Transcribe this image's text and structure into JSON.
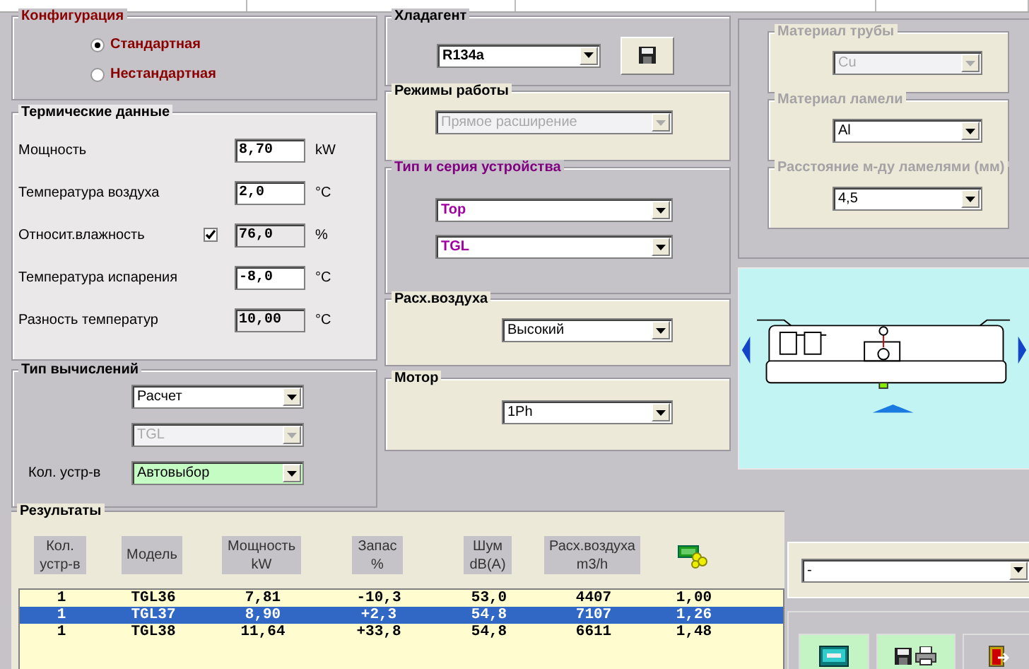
{
  "configuration": {
    "title": "Конфигурация",
    "options": [
      {
        "label": "Стандартная",
        "selected": true
      },
      {
        "label": "Нестандартная",
        "selected": false
      }
    ]
  },
  "thermal": {
    "title": "Термические данные",
    "rows": [
      {
        "label": "Мощность",
        "value": "8,70",
        "unit": "kW",
        "editable": true
      },
      {
        "label": "Температура воздуха",
        "value": "2,0",
        "unit": "°C",
        "editable": true
      },
      {
        "label": "Относит.влажность",
        "value": "76,0",
        "unit": "%",
        "editable": false,
        "checkbox": {
          "checked": true
        }
      },
      {
        "label": "Температура испарения",
        "value": "-8,0",
        "unit": "°C",
        "editable": true
      },
      {
        "label": "Разность температур",
        "value": "10,00",
        "unit": "°C",
        "editable": false
      }
    ]
  },
  "calculation": {
    "title": "Тип вычислений",
    "selects": [
      {
        "value": "Расчет",
        "disabled": false,
        "highlighted": false
      },
      {
        "value": "TGL",
        "disabled": true,
        "highlighted": false
      },
      {
        "label": "Кол. устр-в",
        "value": "Автовыбор",
        "disabled": false,
        "highlighted": true
      }
    ]
  },
  "refrigerant": {
    "title": "Хладагент",
    "value": "R134a"
  },
  "mode": {
    "title": "Режимы работы",
    "value": "Прямое расширение",
    "disabled": true
  },
  "device": {
    "title": "Тип и серия устройства",
    "selects": [
      {
        "value": "Top"
      },
      {
        "value": "TGL"
      }
    ]
  },
  "airflow": {
    "title": "Расх.воздуха",
    "value": "Высокий"
  },
  "motor": {
    "title": "Мотор",
    "value": "1Ph"
  },
  "materials": [
    {
      "title": "Материал трубы",
      "value": "Cu",
      "disabled": true
    },
    {
      "title": "Материал ламели",
      "value": "Al",
      "disabled": false
    },
    {
      "title": "Расстояние м-ду ламелями (мм)",
      "value": "4,5",
      "disabled": false
    }
  ],
  "results": {
    "title": "Результаты",
    "columns": [
      {
        "lines": [
          "Кол.",
          "устр-в"
        ]
      },
      {
        "lines": [
          "Модель"
        ]
      },
      {
        "lines": [
          "Мощность",
          "kW"
        ]
      },
      {
        "lines": [
          "Запас",
          "%"
        ]
      },
      {
        "lines": [
          "Шум",
          "dB(A)"
        ]
      },
      {
        "lines": [
          "Расх.воздуха",
          "m3/h"
        ]
      }
    ],
    "rows": [
      {
        "cells": [
          "1",
          "TGL36",
          "7,81",
          "-10,3",
          "53,0",
          "4407",
          "1,00"
        ],
        "selected": false
      },
      {
        "cells": [
          "1",
          "TGL37",
          "8,90",
          "+2,3",
          "54,8",
          "7107",
          "1,26"
        ],
        "selected": true
      },
      {
        "cells": [
          "1",
          "TGL38",
          "11,64",
          "+33,8",
          "54,8",
          "6611",
          "1,48"
        ],
        "selected": false
      }
    ]
  },
  "output": {
    "value": "-"
  }
}
